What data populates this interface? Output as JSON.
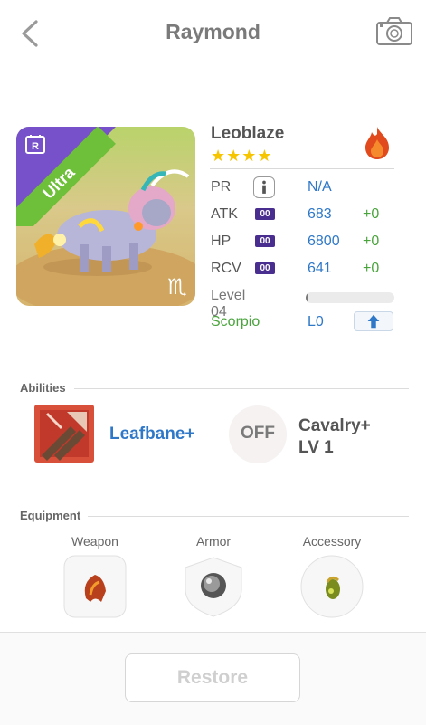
{
  "header": {
    "title": "Raymond",
    "back_icon": "chevron-left-icon",
    "camera_icon": "camera-icon"
  },
  "monster": {
    "name": "Leoblaze",
    "stars": "★★★★",
    "star_count": 4,
    "rarity": "Ultra",
    "rarity_badge": "R",
    "element_icon": "fire-icon",
    "zodiac_symbol": "♏",
    "colors": {
      "rarity": "#6ebf3a",
      "rarity_corner": "#7651c9",
      "value": "#2f78c8",
      "bonus": "#4aa43c"
    }
  },
  "stats": [
    {
      "label": "PR",
      "badge": "",
      "value": "N/A",
      "bonus": ""
    },
    {
      "label": "ATK",
      "badge": "00",
      "value": "683",
      "bonus": "+0"
    },
    {
      "label": "HP",
      "badge": "00",
      "value": "6800",
      "bonus": "+0"
    },
    {
      "label": "RCV",
      "badge": "00",
      "value": "641",
      "bonus": "+0"
    }
  ],
  "level": {
    "label": "Level 04",
    "progress": 0.02
  },
  "zodiac": {
    "label": "Scorpio",
    "value": "L0"
  },
  "abilities": {
    "title": "Abilities",
    "primary": {
      "name": "Leafbane+"
    },
    "secondary": {
      "status": "OFF",
      "name_line1": "Cavalry+",
      "name_line2": "LV 1"
    }
  },
  "equipment": {
    "title": "Equipment",
    "slots": [
      {
        "label": "Weapon"
      },
      {
        "label": "Armor"
      },
      {
        "label": "Accessory"
      }
    ]
  },
  "footer": {
    "restore_label": "Restore"
  }
}
